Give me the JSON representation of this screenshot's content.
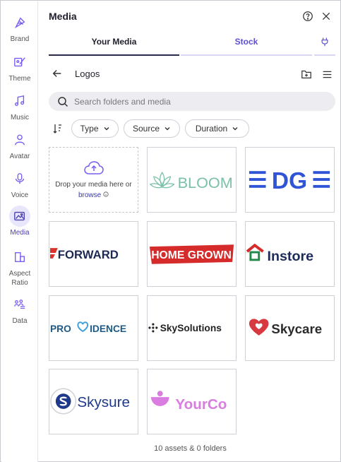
{
  "rail": [
    {
      "label": "Brand",
      "icon": "brand-icon",
      "active": false
    },
    {
      "label": "Theme",
      "icon": "theme-icon",
      "active": false
    },
    {
      "label": "Music",
      "icon": "music-icon",
      "active": false
    },
    {
      "label": "Avatar",
      "icon": "avatar-icon",
      "active": false
    },
    {
      "label": "Voice",
      "icon": "microphone-icon",
      "active": false
    },
    {
      "label": "Media",
      "icon": "media-icon",
      "active": true
    },
    {
      "label": "Aspect\nRatio",
      "icon": "aspect-ratio-icon",
      "active": false
    },
    {
      "label": "Data",
      "icon": "data-icon",
      "active": false
    }
  ],
  "header": {
    "title": "Media"
  },
  "tabs": [
    {
      "label": "Your Media",
      "active": true
    },
    {
      "label": "Stock",
      "active": false
    }
  ],
  "folder": {
    "name": "Logos"
  },
  "search": {
    "placeholder": "Search folders and media",
    "value": ""
  },
  "filters": [
    {
      "label": "Type"
    },
    {
      "label": "Source"
    },
    {
      "label": "Duration"
    }
  ],
  "upload": {
    "text": "Drop your media here or",
    "link": "browse"
  },
  "assets": [
    {
      "name": "BLOOM",
      "color": "#7bc0a7"
    },
    {
      "name": "EDGE",
      "color": "#2f54d6"
    },
    {
      "name": "FORWARD",
      "color": "#1d2952"
    },
    {
      "name": "HOME GROWN",
      "color": "#d62b2b"
    },
    {
      "name": "Instore",
      "color": "#1d2c5a"
    },
    {
      "name": "PROVIDENCE",
      "color": "#1e5a85"
    },
    {
      "name": "SkySolutions",
      "color": "#222222"
    },
    {
      "name": "Skycare",
      "color": "#2b2b2b"
    },
    {
      "name": "Skysure",
      "color": "#1f3a8a"
    },
    {
      "name": "YourCo",
      "color": "#da7de0"
    }
  ],
  "footer": {
    "summary": "10 assets & 0 folders"
  },
  "colors": {
    "accent": "#5b4fd0",
    "rail_icon": "#7a5cf0"
  }
}
